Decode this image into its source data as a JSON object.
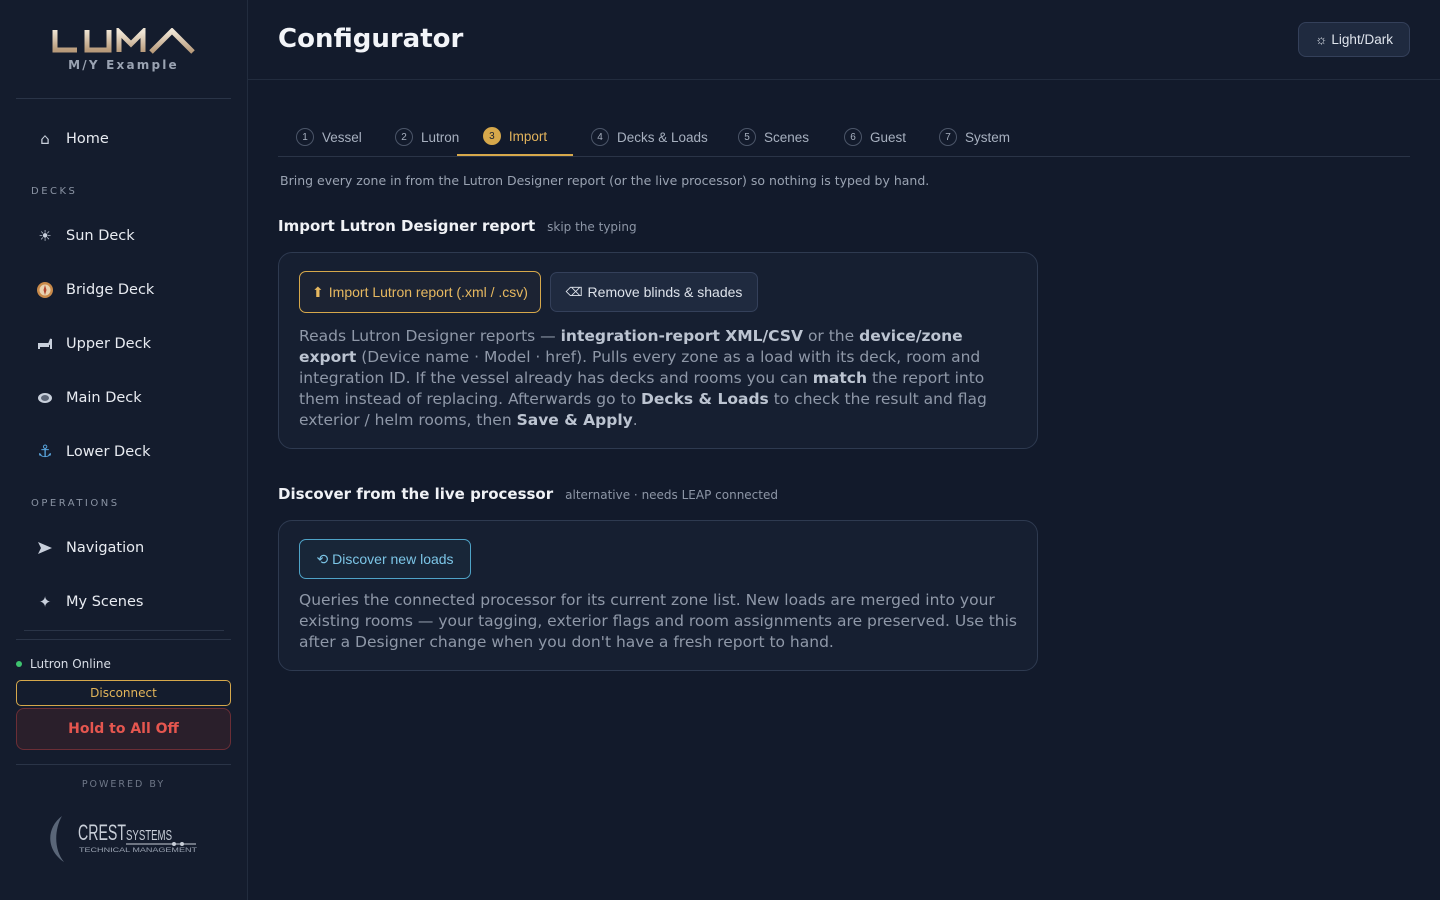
{
  "brand": {
    "logo": "LUMA",
    "subtitle": "M/Y Example"
  },
  "sidebar": {
    "home": {
      "label": "Home",
      "icon": "home-icon"
    },
    "decks_label": "DECKS",
    "decks": [
      {
        "label": "Sun Deck",
        "icon": "sun-icon"
      },
      {
        "label": "Bridge Deck",
        "icon": "compass-icon"
      },
      {
        "label": "Upper Deck",
        "icon": "chair-icon"
      },
      {
        "label": "Main Deck",
        "icon": "dome-light-icon"
      },
      {
        "label": "Lower Deck",
        "icon": "anchor-icon"
      }
    ],
    "operations_label": "OPERATIONS",
    "operations": [
      {
        "label": "Navigation",
        "icon": "arrow-icon"
      },
      {
        "label": "My Scenes",
        "icon": "sparkle-icon"
      }
    ],
    "status": "Lutron Online",
    "disconnect": "Disconnect",
    "all_off": "Hold to All Off",
    "powered_by": "POWERED BY",
    "partner_logo": "CREST SYSTEMS",
    "partner_tagline": "TECHNICAL MANAGEMENT"
  },
  "header": {
    "title": "Configurator",
    "theme_toggle": "Light/Dark"
  },
  "tabs": [
    {
      "num": "1",
      "label": "Vessel"
    },
    {
      "num": "2",
      "label": "Lutron"
    },
    {
      "num": "3",
      "label": "Import",
      "active": true
    },
    {
      "num": "4",
      "label": "Decks & Loads"
    },
    {
      "num": "5",
      "label": "Scenes"
    },
    {
      "num": "6",
      "label": "Guest"
    },
    {
      "num": "7",
      "label": "System"
    }
  ],
  "main": {
    "intro": "Bring every zone in from the Lutron Designer report (or the live processor) so nothing is typed by hand.",
    "import_section": {
      "title": "Import Lutron Designer report",
      "hint": "skip the typing",
      "import_button": "Import Lutron report (.xml / .csv)",
      "remove_button": "Remove blinds & shades",
      "desc": {
        "t1": "Reads Lutron Designer reports — ",
        "b1": "integration-report XML/CSV",
        "t2": " or the ",
        "b2": "device/zone export",
        "t3": " (Device name · Model · href). Pulls every zone as a load with its deck, room and integration ID. If the vessel already has decks and rooms you can ",
        "b3": "match",
        "t4": " the report into them instead of replacing. Afterwards go to ",
        "b4": "Decks & Loads",
        "t5": " to check the result and flag exterior / helm rooms, then ",
        "b5": "Save & Apply",
        "t6": "."
      }
    },
    "discover_section": {
      "title": "Discover from the live processor",
      "hint": "alternative · needs LEAP connected",
      "discover_button": "Discover new loads",
      "desc": "Queries the connected processor for its current zone list. New loads are merged into your existing rooms — your tagging, exterior flags and room assignments are preserved. Use this after a Designer change when you don't have a fresh report to hand."
    }
  },
  "colors": {
    "accent": "#d6a84b",
    "teal": "#4fa3c7",
    "danger": "#e5564f",
    "online": "#3ec36f"
  }
}
